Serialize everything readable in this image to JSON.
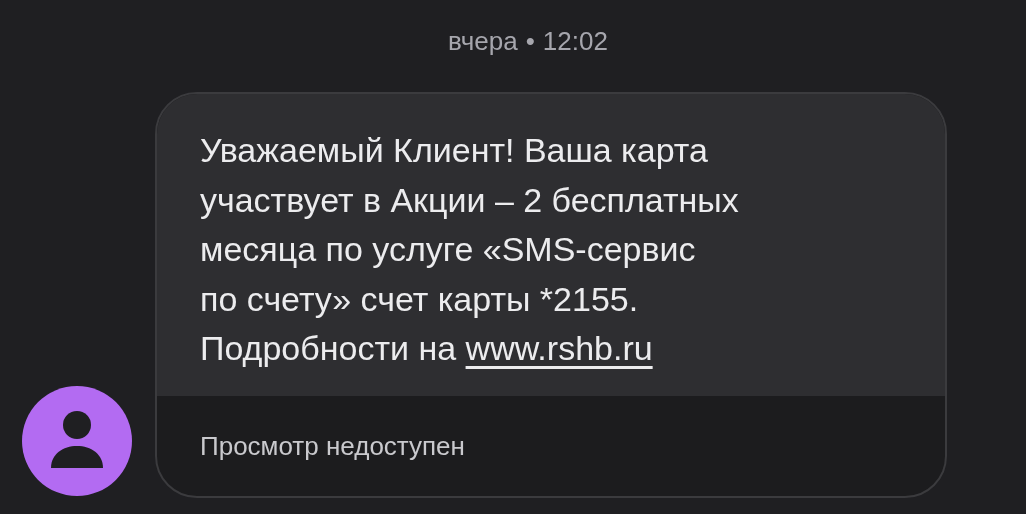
{
  "timestamp": {
    "day": "вчера",
    "separator": "•",
    "time": "12:02"
  },
  "message": {
    "lines": [
      "Уважаемый Клиент! Ваша карта",
      "участвует в Акции – 2 бесплатных",
      "месяца по услуге «SMS-сервис",
      "по счету» счет карты *2155.",
      "Подробности на"
    ],
    "link": "www.rshb.ru"
  },
  "preview": {
    "status": "Просмотр недоступен"
  }
}
